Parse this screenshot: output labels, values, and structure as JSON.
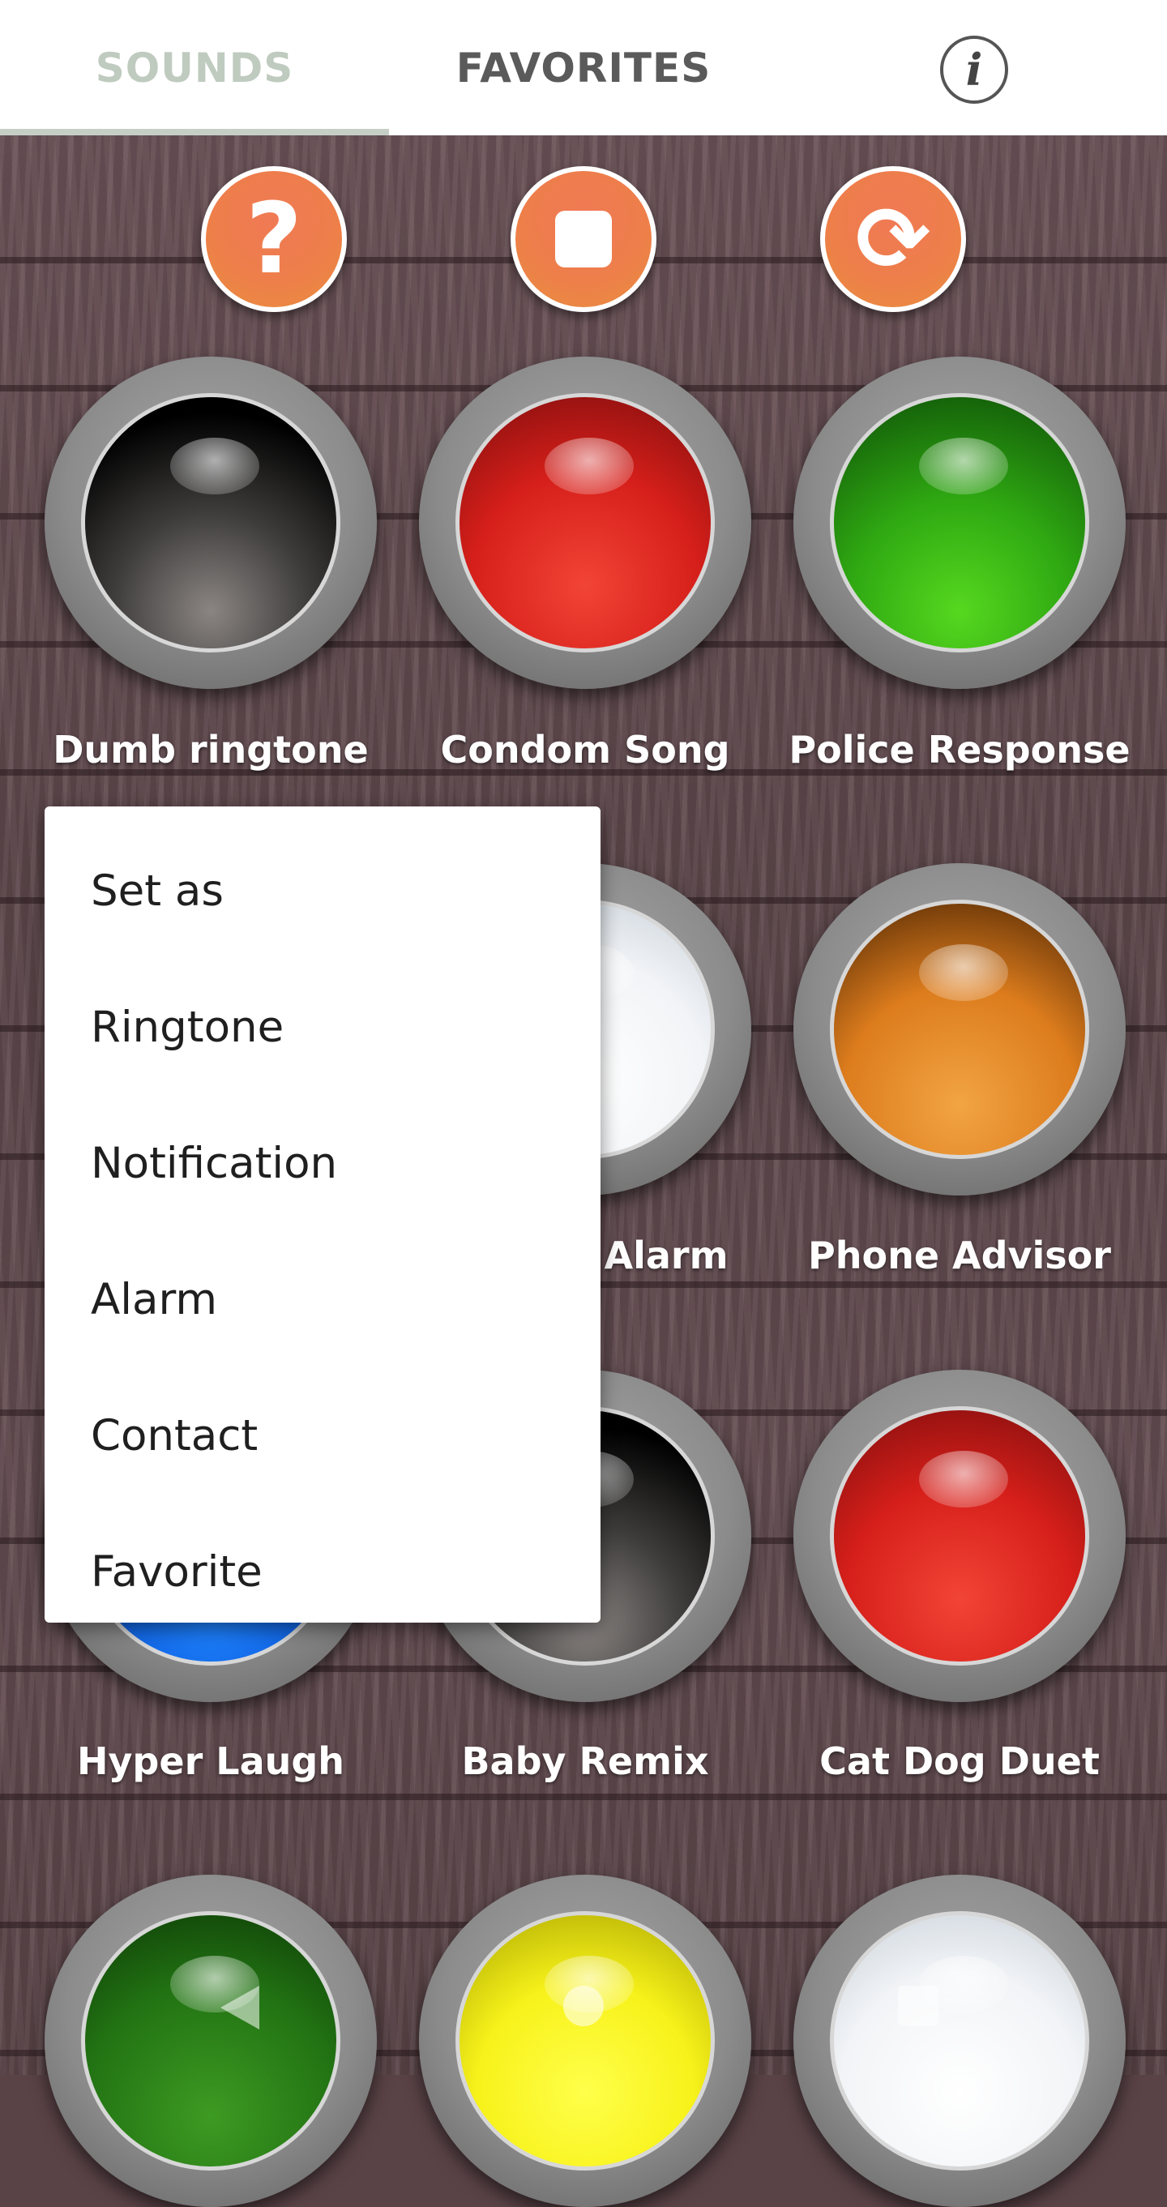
{
  "tabs": {
    "sounds_label": "SOUNDS",
    "favorites_label": "FAVORITES",
    "active": "SOUNDS"
  },
  "info_icon": "i",
  "controls": {
    "help_icon": "question-icon",
    "help_glyph": "?",
    "stop_icon": "stop-icon",
    "refresh_icon": "refresh-icon",
    "refresh_glyph": "⟳"
  },
  "sounds": [
    {
      "label": "Dumb ringtone",
      "color": "black"
    },
    {
      "label": "Condom Song",
      "color": "red"
    },
    {
      "label": "Police Response",
      "color": "green"
    },
    {
      "label": "Alarm",
      "color": "white"
    },
    {
      "label": "Phone Advisor",
      "color": "orange"
    },
    {
      "label": "Hyper Laugh",
      "color": "blue"
    },
    {
      "label": "Baby Remix",
      "color": "black"
    },
    {
      "label": "Cat Dog Duet",
      "color": "red"
    },
    {
      "label": "",
      "color": "green"
    },
    {
      "label": "",
      "color": "yellow"
    },
    {
      "label": "",
      "color": "white"
    }
  ],
  "menu": {
    "items": [
      "Set as",
      "Ringtone",
      "Notification",
      "Alarm",
      "Contact",
      "Favorite"
    ]
  },
  "colors": {
    "accent_button": "#ee7e4a",
    "tab_active": "#c0cbc0",
    "tab_inactive": "#5a5a5a"
  }
}
